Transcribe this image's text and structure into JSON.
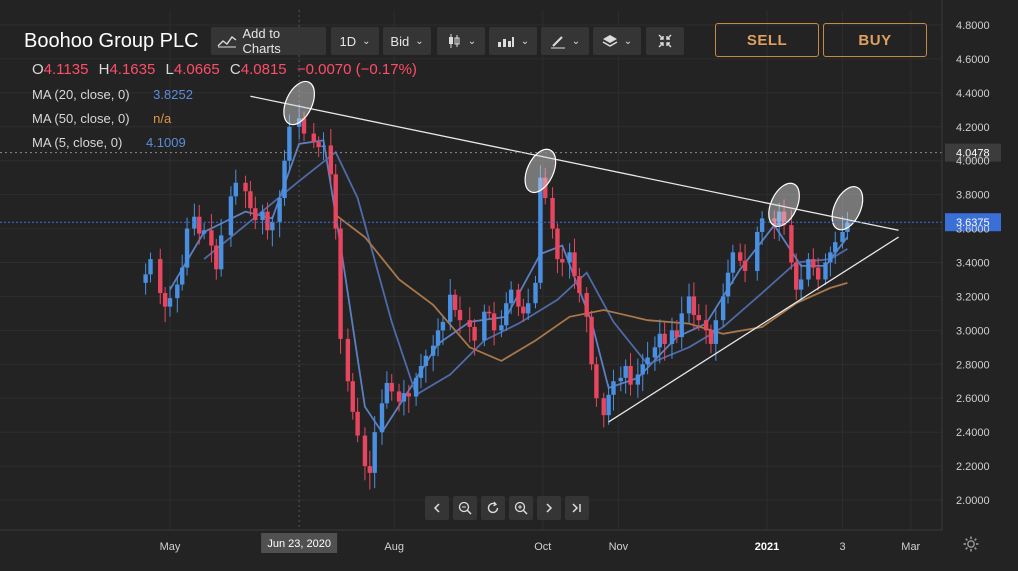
{
  "header": {
    "instrument": "Boohoo Group PLC",
    "add_to_charts": "Add to Charts",
    "interval": "1D",
    "price_side": "Bid",
    "sell_label": "SELL",
    "buy_label": "BUY",
    "icons": [
      "candlestick-icon",
      "bar-type-icon",
      "draw-pencil-icon",
      "layers-icon",
      "collapse-icon"
    ]
  },
  "ohlc": {
    "o_label": "O",
    "o": "4.1135",
    "h_label": "H",
    "h": "4.1635",
    "l_label": "L",
    "l": "4.0665",
    "c_label": "C",
    "c": "4.0815",
    "change": "−0.0070 (−0.17%)"
  },
  "indicators": [
    {
      "label": "MA (20, close, 0)",
      "value": "3.8252",
      "color": "#5b8dd9"
    },
    {
      "label": "MA (50, close, 0)",
      "value": "n/a",
      "color": "#e0954a"
    },
    {
      "label": "MA (5, close, 0)",
      "value": "4.1009",
      "color": "#5b8dd9"
    }
  ],
  "colors": {
    "background": "#232323",
    "up": "#4a90e2",
    "down": "#e8465f",
    "ma_blue": "#5b7fc0",
    "ma_orange": "#a8774a",
    "accent_orange": "#e0a060",
    "crosshair_badge": "#3a6fd8"
  },
  "chart_data": {
    "type": "candlestick",
    "yaxis": {
      "ylim": [
        1.9,
        4.85
      ],
      "ticks": [
        "4.8000",
        "4.6000",
        "4.4000",
        "4.2000",
        "4.0000",
        "3.8000",
        "3.6000",
        "3.4000",
        "3.2000",
        "3.0000",
        "2.8000",
        "2.6000",
        "2.4000",
        "2.2000",
        "2.0000"
      ],
      "last_price_label": "4.0478",
      "crosshair_price_label": "3.6375"
    },
    "xaxis": {
      "xlim": [
        "2020-04-15",
        "2021-03-01"
      ],
      "ticks": [
        {
          "date": "2020-05-01",
          "label": "May"
        },
        {
          "date": "2020-08-01",
          "label": "Aug"
        },
        {
          "date": "2020-10-01",
          "label": "Oct"
        },
        {
          "date": "2020-11-01",
          "label": "Nov"
        },
        {
          "date": "2021-01-01",
          "label": "2021"
        },
        {
          "date": "2021-02-01",
          "label": "3"
        },
        {
          "date": "2021-03-01",
          "label": "Mar"
        }
      ],
      "crosshair_date": "2020-06-23",
      "crosshair_label": "Jun 23, 2020"
    },
    "close_series": [
      [
        "2020-04-21",
        3.33
      ],
      [
        "2020-04-23",
        3.42
      ],
      [
        "2020-04-27",
        3.22
      ],
      [
        "2020-04-29",
        3.14
      ],
      [
        "2020-05-01",
        3.19
      ],
      [
        "2020-05-04",
        3.27
      ],
      [
        "2020-05-06",
        3.37
      ],
      [
        "2020-05-08",
        3.6
      ],
      [
        "2020-05-11",
        3.67
      ],
      [
        "2020-05-13",
        3.57
      ],
      [
        "2020-05-15",
        3.59
      ],
      [
        "2020-05-18",
        3.5
      ],
      [
        "2020-05-20",
        3.36
      ],
      [
        "2020-05-22",
        3.56
      ],
      [
        "2020-05-26",
        3.79
      ],
      [
        "2020-05-28",
        3.87
      ],
      [
        "2020-06-01",
        3.82
      ],
      [
        "2020-06-03",
        3.72
      ],
      [
        "2020-06-05",
        3.65
      ],
      [
        "2020-06-08",
        3.7
      ],
      [
        "2020-06-10",
        3.59
      ],
      [
        "2020-06-12",
        3.64
      ],
      [
        "2020-06-15",
        3.78
      ],
      [
        "2020-06-17",
        4.0
      ],
      [
        "2020-06-19",
        4.2
      ],
      [
        "2020-06-23",
        4.25
      ],
      [
        "2020-06-25",
        4.16
      ],
      [
        "2020-06-29",
        4.11
      ],
      [
        "2020-07-01",
        4.08
      ],
      [
        "2020-07-03",
        4.09
      ],
      [
        "2020-07-06",
        3.92
      ],
      [
        "2020-07-08",
        3.6
      ],
      [
        "2020-07-10",
        2.95
      ],
      [
        "2020-07-13",
        2.7
      ],
      [
        "2020-07-15",
        2.52
      ],
      [
        "2020-07-17",
        2.38
      ],
      [
        "2020-07-20",
        2.2
      ],
      [
        "2020-07-22",
        2.16
      ],
      [
        "2020-07-24",
        2.4
      ],
      [
        "2020-07-27",
        2.57
      ],
      [
        "2020-07-29",
        2.69
      ],
      [
        "2020-07-31",
        2.64
      ],
      [
        "2020-08-03",
        2.58
      ],
      [
        "2020-08-05",
        2.63
      ],
      [
        "2020-08-07",
        2.61
      ],
      [
        "2020-08-10",
        2.72
      ],
      [
        "2020-08-12",
        2.79
      ],
      [
        "2020-08-14",
        2.85
      ],
      [
        "2020-08-17",
        2.91
      ],
      [
        "2020-08-19",
        3.0
      ],
      [
        "2020-08-21",
        3.05
      ],
      [
        "2020-08-24",
        3.21
      ],
      [
        "2020-08-26",
        3.12
      ],
      [
        "2020-08-28",
        3.06
      ],
      [
        "2020-09-01",
        3.02
      ],
      [
        "2020-09-03",
        2.94
      ],
      [
        "2020-09-07",
        3.11
      ],
      [
        "2020-09-09",
        3.1
      ],
      [
        "2020-09-11",
        3.0
      ],
      [
        "2020-09-14",
        3.03
      ],
      [
        "2020-09-16",
        3.16
      ],
      [
        "2020-09-18",
        3.24
      ],
      [
        "2020-09-21",
        3.14
      ],
      [
        "2020-09-23",
        3.1
      ],
      [
        "2020-09-25",
        3.16
      ],
      [
        "2020-09-28",
        3.28
      ],
      [
        "2020-09-30",
        3.9
      ],
      [
        "2020-10-02",
        3.78
      ],
      [
        "2020-10-05",
        3.6
      ],
      [
        "2020-10-07",
        3.42
      ],
      [
        "2020-10-09",
        3.4
      ],
      [
        "2020-10-12",
        3.46
      ],
      [
        "2020-10-14",
        3.32
      ],
      [
        "2020-10-16",
        3.22
      ],
      [
        "2020-10-19",
        3.08
      ],
      [
        "2020-10-21",
        2.8
      ],
      [
        "2020-10-23",
        2.6
      ],
      [
        "2020-10-26",
        2.5
      ],
      [
        "2020-10-28",
        2.62
      ],
      [
        "2020-10-30",
        2.7
      ],
      [
        "2020-11-02",
        2.72
      ],
      [
        "2020-11-04",
        2.79
      ],
      [
        "2020-11-06",
        2.68
      ],
      [
        "2020-11-09",
        2.74
      ],
      [
        "2020-11-11",
        2.8
      ],
      [
        "2020-11-13",
        2.84
      ],
      [
        "2020-11-16",
        2.9
      ],
      [
        "2020-11-18",
        2.98
      ],
      [
        "2020-11-20",
        2.92
      ],
      [
        "2020-11-23",
        3.0
      ],
      [
        "2020-11-25",
        2.96
      ],
      [
        "2020-11-27",
        3.1
      ],
      [
        "2020-11-30",
        3.2
      ],
      [
        "2020-12-02",
        3.09
      ],
      [
        "2020-12-04",
        3.06
      ],
      [
        "2020-12-07",
        3.0
      ],
      [
        "2020-12-09",
        2.92
      ],
      [
        "2020-12-11",
        3.06
      ],
      [
        "2020-12-14",
        3.2
      ],
      [
        "2020-12-16",
        3.34
      ],
      [
        "2020-12-18",
        3.46
      ],
      [
        "2020-12-21",
        3.41
      ],
      [
        "2020-12-23",
        3.35
      ],
      [
        "2020-12-28",
        3.58
      ],
      [
        "2020-12-30",
        3.66
      ],
      [
        "2021-01-04",
        3.62
      ],
      [
        "2021-01-06",
        3.7
      ],
      [
        "2021-01-08",
        3.62
      ],
      [
        "2021-01-11",
        3.4
      ],
      [
        "2021-01-13",
        3.24
      ],
      [
        "2021-01-15",
        3.3
      ],
      [
        "2021-01-18",
        3.42
      ],
      [
        "2021-01-20",
        3.37
      ],
      [
        "2021-01-22",
        3.3
      ],
      [
        "2021-01-25",
        3.4
      ],
      [
        "2021-01-27",
        3.46
      ],
      [
        "2021-01-29",
        3.52
      ],
      [
        "2021-02-01",
        3.58
      ],
      [
        "2021-02-03",
        3.64
      ]
    ],
    "moving_averages": [
      {
        "name": "MA (5, close, 0)",
        "color": "#5b7fc0",
        "points": [
          [
            "2020-05-01",
            3.24
          ],
          [
            "2020-05-15",
            3.58
          ],
          [
            "2020-06-01",
            3.7
          ],
          [
            "2020-06-12",
            3.66
          ],
          [
            "2020-06-23",
            4.1
          ],
          [
            "2020-07-03",
            4.12
          ],
          [
            "2020-07-10",
            3.5
          ],
          [
            "2020-07-20",
            2.55
          ],
          [
            "2020-07-27",
            2.4
          ],
          [
            "2020-08-05",
            2.6
          ],
          [
            "2020-08-19",
            2.92
          ],
          [
            "2020-09-01",
            3.05
          ],
          [
            "2020-09-16",
            3.08
          ],
          [
            "2020-09-30",
            3.45
          ],
          [
            "2020-10-09",
            3.5
          ],
          [
            "2020-10-21",
            3.05
          ],
          [
            "2020-10-28",
            2.66
          ],
          [
            "2020-11-09",
            2.72
          ],
          [
            "2020-11-25",
            2.96
          ],
          [
            "2020-12-07",
            3.04
          ],
          [
            "2020-12-21",
            3.36
          ],
          [
            "2021-01-04",
            3.62
          ],
          [
            "2021-01-15",
            3.38
          ],
          [
            "2021-01-25",
            3.38
          ],
          [
            "2021-02-03",
            3.55
          ]
        ]
      },
      {
        "name": "MA (20, close, 0)",
        "color": "#4e6aa8",
        "points": [
          [
            "2020-05-15",
            3.42
          ],
          [
            "2020-06-01",
            3.62
          ],
          [
            "2020-06-23",
            3.88
          ],
          [
            "2020-07-08",
            4.05
          ],
          [
            "2020-07-17",
            3.78
          ],
          [
            "2020-07-31",
            3.05
          ],
          [
            "2020-08-10",
            2.62
          ],
          [
            "2020-08-24",
            2.74
          ],
          [
            "2020-09-07",
            2.94
          ],
          [
            "2020-09-21",
            3.04
          ],
          [
            "2020-10-07",
            3.18
          ],
          [
            "2020-10-19",
            3.34
          ],
          [
            "2020-10-30",
            3.05
          ],
          [
            "2020-11-13",
            2.8
          ],
          [
            "2020-11-30",
            2.9
          ],
          [
            "2020-12-14",
            3.02
          ],
          [
            "2020-12-30",
            3.22
          ],
          [
            "2021-01-13",
            3.4
          ],
          [
            "2021-01-27",
            3.42
          ],
          [
            "2021-02-03",
            3.48
          ]
        ]
      },
      {
        "name": "MA (50, close, 0)",
        "color": "#a8774a",
        "points": [
          [
            "2020-07-08",
            3.68
          ],
          [
            "2020-07-20",
            3.55
          ],
          [
            "2020-08-03",
            3.3
          ],
          [
            "2020-08-17",
            3.15
          ],
          [
            "2020-09-01",
            2.9
          ],
          [
            "2020-09-14",
            2.82
          ],
          [
            "2020-09-28",
            2.94
          ],
          [
            "2020-10-12",
            3.08
          ],
          [
            "2020-10-26",
            3.12
          ],
          [
            "2020-11-13",
            3.06
          ],
          [
            "2020-11-30",
            3.04
          ],
          [
            "2020-12-14",
            2.98
          ],
          [
            "2020-12-30",
            3.02
          ],
          [
            "2021-01-13",
            3.16
          ],
          [
            "2021-01-27",
            3.25
          ],
          [
            "2021-02-03",
            3.28
          ]
        ]
      }
    ],
    "trendlines": [
      {
        "name": "resistance",
        "from": [
          "2020-06-03",
          4.38
        ],
        "to": [
          "2021-02-24",
          3.59
        ]
      },
      {
        "name": "support",
        "from": [
          "2020-10-28",
          2.46
        ],
        "to": [
          "2021-02-24",
          3.55
        ]
      }
    ],
    "highlight_ellipses": [
      [
        "2020-06-23",
        4.34
      ],
      [
        "2020-09-30",
        3.94
      ],
      [
        "2021-01-08",
        3.74
      ],
      [
        "2021-02-03",
        3.72
      ]
    ]
  },
  "navigation": {
    "icons": [
      "chevron-left-icon",
      "zoom-out-icon",
      "reset-icon",
      "zoom-in-icon",
      "chevron-right-icon",
      "jump-to-latest-icon"
    ]
  }
}
